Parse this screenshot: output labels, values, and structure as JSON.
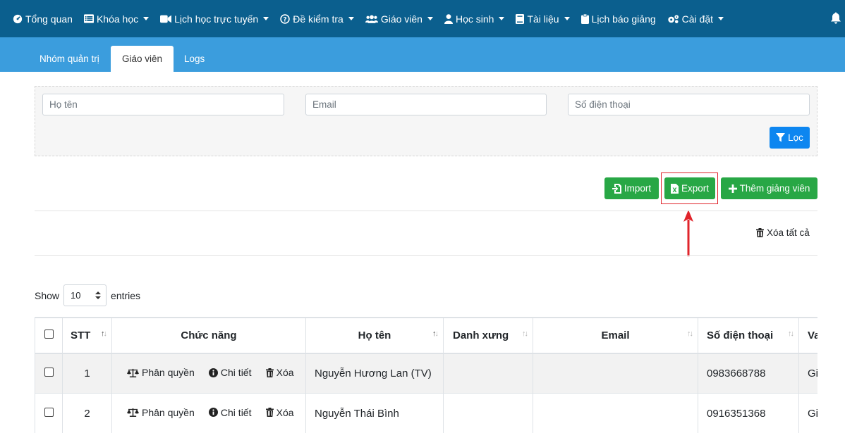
{
  "nav": {
    "items": [
      {
        "label": "Tổng quan",
        "icon": "dashboard-icon",
        "caret": false
      },
      {
        "label": "Khóa học",
        "icon": "list-icon",
        "caret": true
      },
      {
        "label": "Lịch học trực tuyến",
        "icon": "video-icon",
        "caret": true
      },
      {
        "label": "Đề kiểm tra",
        "icon": "question-circle-icon",
        "caret": true
      },
      {
        "label": "Giáo viên",
        "icon": "users-icon",
        "caret": true
      },
      {
        "label": "Học sinh",
        "icon": "user-icon",
        "caret": true
      },
      {
        "label": "Tài liệu",
        "icon": "book-icon",
        "caret": true
      },
      {
        "label": "Lịch báo giảng",
        "icon": "clipboard-icon",
        "caret": false
      },
      {
        "label": "Cài đặt",
        "icon": "cogs-icon",
        "caret": true
      }
    ]
  },
  "tabs": [
    {
      "label": "Nhóm quản trị",
      "active": false
    },
    {
      "label": "Giáo viên",
      "active": true
    },
    {
      "label": "Logs",
      "active": false
    }
  ],
  "filter": {
    "name_placeholder": "Họ tên",
    "email_placeholder": "Email",
    "phone_placeholder": "Số điện thoại",
    "filter_button": "Lọc"
  },
  "actions": {
    "import": "Import",
    "export": "Export",
    "add_teacher": "Thêm giảng viên",
    "delete_all": "Xóa tất cả"
  },
  "length_menu": {
    "show": "Show",
    "value": "10",
    "entries": "entries"
  },
  "table": {
    "headers": [
      "STT",
      "Chức năng",
      "Họ tên",
      "Danh xưng",
      "Email",
      "Số điện thoại",
      "Va"
    ],
    "row_actions": {
      "permission": "Phân quyền",
      "detail": "Chi tiết",
      "delete": "Xóa"
    },
    "rows": [
      {
        "stt": "1",
        "name": "Nguyễn Hương Lan (TV)",
        "title": "",
        "email": "",
        "phone": "0983668788",
        "extra": "Gi"
      },
      {
        "stt": "2",
        "name": "Nguyễn Thái Bình",
        "title": "",
        "email": "",
        "phone": "0916351368",
        "extra": "Gi"
      }
    ]
  },
  "colors": {
    "topbar": "#0b5f8e",
    "tabbar": "#3b9ddd",
    "primary_button": "#0d86f0",
    "success_button": "#28a745",
    "highlight": "#e0242b"
  }
}
